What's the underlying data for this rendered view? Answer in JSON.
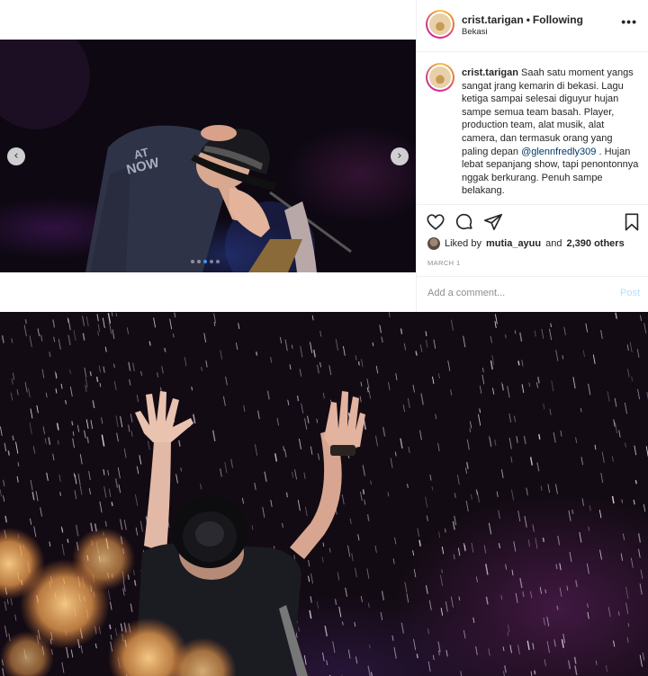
{
  "post": {
    "media": {
      "prev_arrow": "‹",
      "next_arrow": "›",
      "carousel_total": 5,
      "carousel_active": 3,
      "shirt_text_1": "AT",
      "shirt_text_2": "NOW"
    },
    "header": {
      "username": "crist.tarigan",
      "separator": "•",
      "follow_status": "Following",
      "location": "Bekasi",
      "more_icon": "•••"
    },
    "caption": {
      "username": "crist.tarigan",
      "text_before_mention": "Saah satu moment yangs sangat jrang kemarin di bekasi. Lagu ketiga sampai selesai diguyur hujan sampe semua team basah. Player, production team, alat musik, alat camera, dan termasuk orang yang paling depan",
      "mention": "@glennfredly309",
      "text_after_mention": ". Hujan lebat sepanjang show, tapi penontonnya nggak berkurang. Penuh sampe belakang.",
      "trailing": "."
    },
    "actions": {
      "like_icon": "heart-icon",
      "comment_icon": "comment-icon",
      "share_icon": "share-icon",
      "save_icon": "bookmark-icon"
    },
    "likes": {
      "prefix": "Liked by",
      "user": "mutia_ayuu",
      "middle": "and",
      "others": "2,390 others"
    },
    "date": "MARCH 1",
    "comment": {
      "placeholder": "Add a comment...",
      "post_label": "Post"
    }
  },
  "colors": {
    "text": "#262626",
    "muted": "#8e8e8e",
    "mention": "#00376b",
    "post_disabled": "#b2dffc",
    "carousel_active": "#3897f0"
  }
}
